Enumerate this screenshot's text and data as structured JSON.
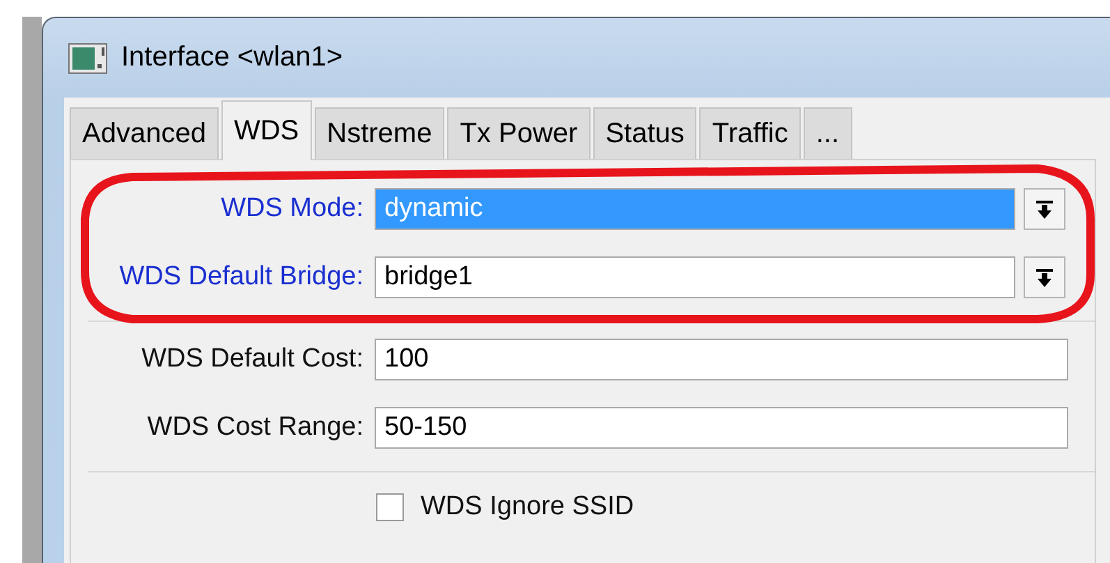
{
  "window": {
    "title": "Interface <wlan1>"
  },
  "tabs": [
    {
      "label": "Advanced",
      "selected": false
    },
    {
      "label": "WDS",
      "selected": true
    },
    {
      "label": "Nstreme",
      "selected": false
    },
    {
      "label": "Tx Power",
      "selected": false
    },
    {
      "label": "Status",
      "selected": false
    },
    {
      "label": "Traffic",
      "selected": false
    },
    {
      "label": "...",
      "selected": false
    }
  ],
  "groups": [
    {
      "circled": true,
      "fields": [
        {
          "kind": "dropdown",
          "label": "WDS Mode:",
          "value": "dynamic",
          "modified": true,
          "selected": true
        },
        {
          "kind": "dropdown",
          "label": "WDS Default Bridge:",
          "value": "bridge1",
          "modified": true,
          "selected": false
        }
      ]
    },
    {
      "circled": false,
      "fields": [
        {
          "kind": "text",
          "label": "WDS Default Cost:",
          "value": "100",
          "modified": false,
          "selected": false
        },
        {
          "kind": "text",
          "label": "WDS Cost Range:",
          "value": "50-150",
          "modified": false,
          "selected": false
        }
      ]
    }
  ],
  "checkbox": {
    "label": "WDS Ignore SSID",
    "checked": false
  }
}
